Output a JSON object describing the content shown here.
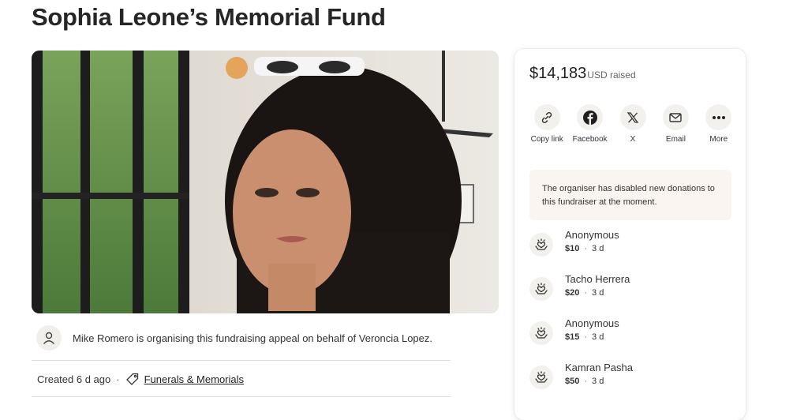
{
  "page": {
    "title": "Sophia Leone’s Memorial Fund"
  },
  "organiser": {
    "text": "Mike Romero is organising this fundraising appeal on behalf of Veroncia Lopez."
  },
  "meta": {
    "created": "Created 6 d ago",
    "separator": "·",
    "category": "Funerals & Memorials"
  },
  "sidebar": {
    "raised_amount": "$14,183",
    "raised_label": "USD raised",
    "share": [
      {
        "label": "Copy link",
        "icon": "link-icon"
      },
      {
        "label": "Facebook",
        "icon": "facebook-icon"
      },
      {
        "label": "X",
        "icon": "x-icon"
      },
      {
        "label": "Email",
        "icon": "email-icon"
      },
      {
        "label": "More",
        "icon": "more-icon"
      }
    ],
    "notice": "The organiser has disabled new donations to this fundraiser at the moment.",
    "donations": [
      {
        "name": "Anonymous",
        "amount": "$10",
        "time": "3 d"
      },
      {
        "name": "Tacho Herrera",
        "amount": "$20",
        "time": "3 d"
      },
      {
        "name": "Anonymous",
        "amount": "$15",
        "time": "3 d"
      },
      {
        "name": "Kamran Pasha",
        "amount": "$50",
        "time": "3 d"
      }
    ],
    "separator": "·"
  },
  "colors": {
    "notice_bg": "#fbf5f1",
    "icon_bg": "#f3f1ee",
    "text": "#2b2b2b"
  }
}
